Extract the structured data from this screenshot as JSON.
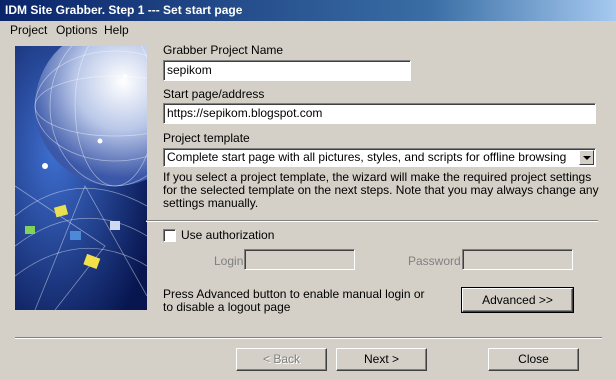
{
  "window": {
    "title": "IDM Site Grabber. Step 1 --- Set start page"
  },
  "menu": [
    "Project",
    "Options",
    "Help"
  ],
  "form": {
    "project_name_label": "Grabber Project Name",
    "project_name_value": "sepikom",
    "start_page_label": "Start page/address",
    "start_page_value": "https://sepikom.blogspot.com",
    "template_label": "Project template",
    "template_value": "Complete start page with all pictures, styles, and scripts for offline browsing",
    "template_description": "If you select a project template, the wizard will make the required project settings for the selected template on the next steps. Note that you may always change any settings manually."
  },
  "auth": {
    "checkbox_label": "Use authorization",
    "checked": false,
    "login_label": "Login",
    "password_label": "Password",
    "login_value": "",
    "password_value": "",
    "advanced_text": "Press Advanced button to enable manual login or to disable a logout page",
    "advanced_button": "Advanced >>"
  },
  "footer": {
    "back_button": "< Back",
    "next_button": "Next >",
    "close_button": "Close"
  },
  "colors": {
    "title_bar": "#0a246a",
    "dialog_bg": "#d4d0c8"
  },
  "illustration": {
    "icon": "globe-network-illustration"
  }
}
